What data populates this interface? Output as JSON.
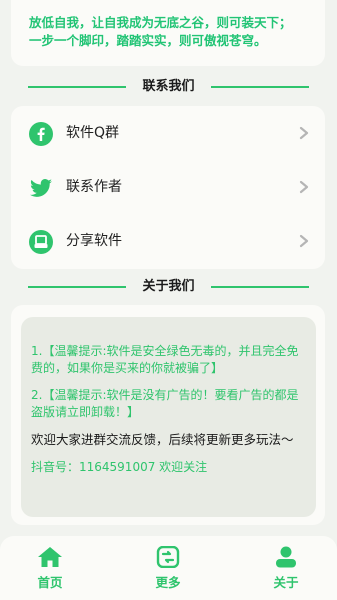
{
  "motto": {
    "line1": "放低自我，让自我成为无底之谷，则可装天下；",
    "line2": "一步一个脚印，踏踏实实，则可傲视苍穹。"
  },
  "contact_section": {
    "title": "联系我们",
    "items": [
      {
        "label": "软件Q群",
        "icon": "facebook-icon"
      },
      {
        "label": "联系作者",
        "icon": "twitter-icon"
      },
      {
        "label": "分享软件",
        "icon": "share-icon"
      }
    ]
  },
  "about_section": {
    "title": "关于我们",
    "tip1": "1.【温馨提示:软件是安全绿色无毒的，并且完全免费的，如果你是买来的你就被骗了】",
    "tip2": "2.【温馨提示:软件是没有广告的！要看广告的都是盗版请立即卸载！】",
    "welcome": "欢迎大家进群交流反馈，后续将更新更多玩法～",
    "douyin": "抖音号：1164591007 欢迎关注"
  },
  "tabbar": {
    "tabs": [
      {
        "label": "首页",
        "icon": "home-icon"
      },
      {
        "label": "更多",
        "icon": "more-icon"
      },
      {
        "label": "关于",
        "icon": "user-icon"
      }
    ]
  },
  "colors": {
    "accent": "#2fc46d",
    "background": "#f1f3ef",
    "card": "#fbfbf8"
  }
}
